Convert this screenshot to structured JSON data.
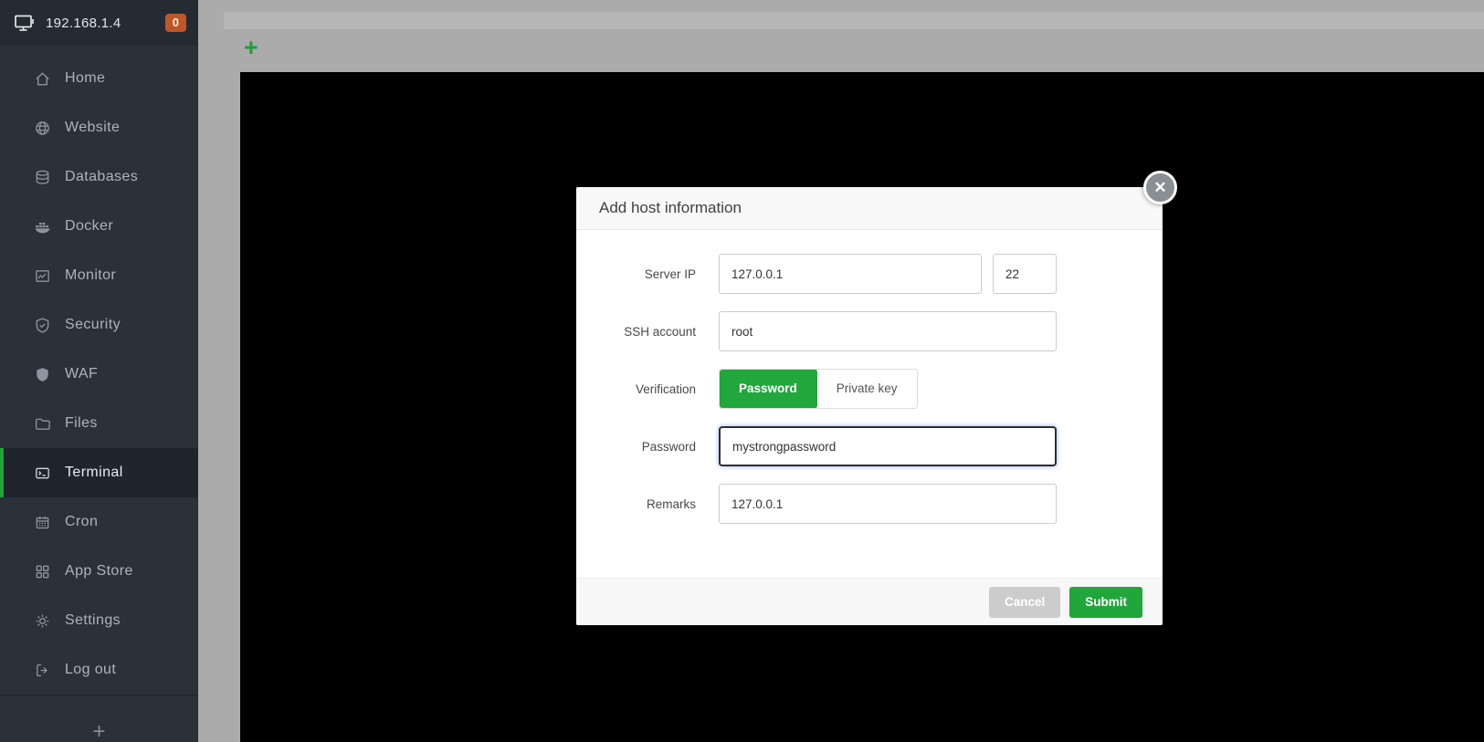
{
  "colors": {
    "accent_green": "#20a53a",
    "badge_orange": "#bf5627",
    "sidebar_bg": "#2b3039",
    "sidebar_active_bg": "#20242c",
    "terminal_black": "#000000",
    "overlay_gray": "#ababab"
  },
  "sidebar": {
    "server": {
      "label": "192.168.1.4",
      "badge_count": "0"
    },
    "items": [
      {
        "label": "Home",
        "icon": "home-icon",
        "active": false
      },
      {
        "label": "Website",
        "icon": "globe-icon",
        "active": false
      },
      {
        "label": "Databases",
        "icon": "database-icon",
        "active": false
      },
      {
        "label": "Docker",
        "icon": "docker-icon",
        "active": false
      },
      {
        "label": "Monitor",
        "icon": "monitor-icon",
        "active": false
      },
      {
        "label": "Security",
        "icon": "shield-check-icon",
        "active": false
      },
      {
        "label": "WAF",
        "icon": "shield-icon",
        "active": false
      },
      {
        "label": "Files",
        "icon": "folder-icon",
        "active": false
      },
      {
        "label": "Terminal",
        "icon": "terminal-icon",
        "active": true
      },
      {
        "label": "Cron",
        "icon": "calendar-icon",
        "active": false
      },
      {
        "label": "App Store",
        "icon": "app-grid-icon",
        "active": false
      },
      {
        "label": "Settings",
        "icon": "gear-icon",
        "active": false
      },
      {
        "label": "Log out",
        "icon": "logout-icon",
        "active": false
      }
    ],
    "expand_glyph": "+"
  },
  "tabbar": {
    "add_tab_glyph": "+"
  },
  "modal": {
    "title": "Add host information",
    "close_glyph": "✕",
    "fields": {
      "server_ip": {
        "label": "Server IP",
        "value": "127.0.0.1"
      },
      "port": {
        "value": "22"
      },
      "ssh_account": {
        "label": "SSH account",
        "value": "root"
      },
      "verification": {
        "label": "Verification",
        "options": [
          {
            "label": "Password",
            "selected": true
          },
          {
            "label": "Private key",
            "selected": false
          }
        ]
      },
      "password": {
        "label": "Password",
        "value": "mystrongpassword"
      },
      "remarks": {
        "label": "Remarks",
        "value": "127.0.0.1"
      }
    },
    "footer": {
      "cancel_label": "Cancel",
      "submit_label": "Submit"
    }
  }
}
